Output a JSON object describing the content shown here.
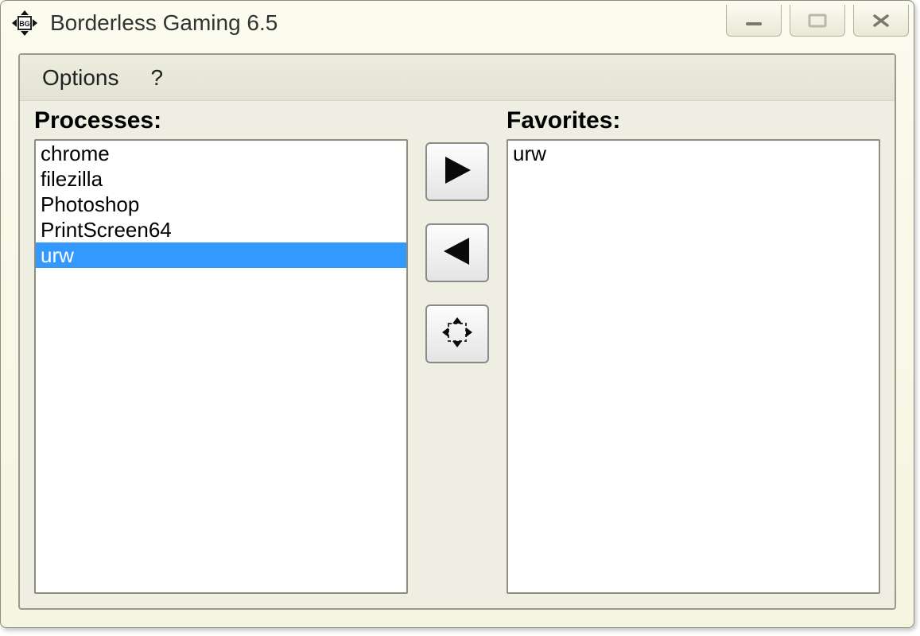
{
  "window": {
    "title": "Borderless Gaming 6.5"
  },
  "menubar": {
    "options": "Options",
    "help": "?"
  },
  "processes": {
    "label": "Processes:",
    "items": [
      {
        "name": "chrome",
        "selected": false
      },
      {
        "name": "filezilla",
        "selected": false
      },
      {
        "name": "Photoshop",
        "selected": false
      },
      {
        "name": "PrintScreen64",
        "selected": false
      },
      {
        "name": "urw",
        "selected": true
      }
    ]
  },
  "favorites": {
    "label": "Favorites:",
    "items": [
      {
        "name": "urw",
        "selected": false
      }
    ]
  },
  "buttons": {
    "add": "add-to-favorites",
    "remove": "remove-from-favorites",
    "fullscreen": "make-borderless"
  }
}
